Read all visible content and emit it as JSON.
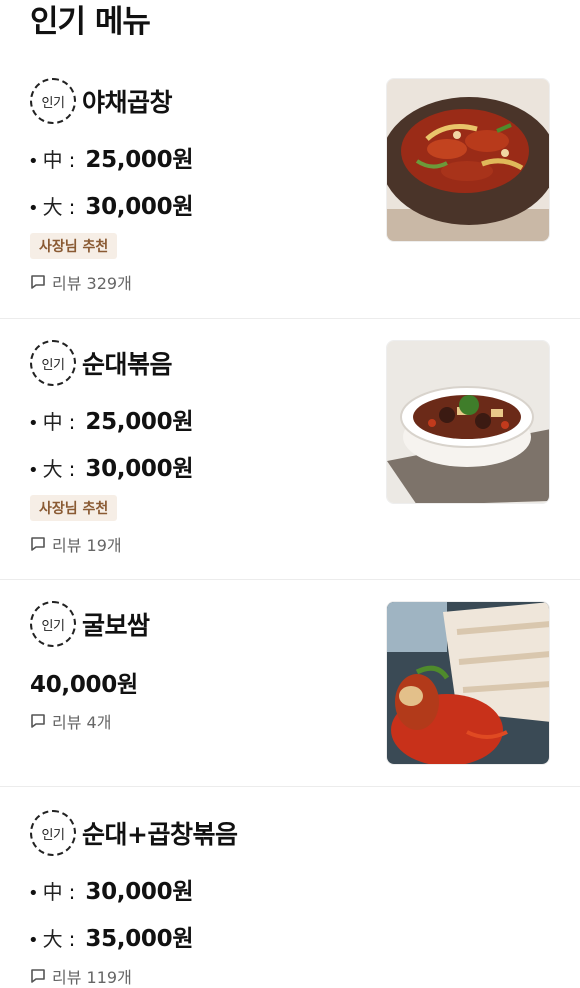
{
  "section": {
    "title": "인기 메뉴"
  },
  "badge_label": "인기",
  "items": [
    {
      "name": "야채곱창",
      "prices": [
        {
          "size": "中",
          "price": "25,000원"
        },
        {
          "size": "大",
          "price": "30,000원"
        }
      ],
      "tag": "사장님 추천",
      "reviews": "리뷰 329개"
    },
    {
      "name": "순대볶음",
      "prices": [
        {
          "size": "中",
          "price": "25,000원"
        },
        {
          "size": "大",
          "price": "30,000원"
        }
      ],
      "tag": "사장님 추천",
      "reviews": "리뷰 19개"
    },
    {
      "name": "굴보쌈",
      "price": "40,000원",
      "reviews": "리뷰 4개"
    },
    {
      "name": "순대+곱창볶음",
      "prices": [
        {
          "size": "中",
          "price": "30,000원"
        },
        {
          "size": "大",
          "price": "35,000원"
        }
      ],
      "reviews": "리뷰 119개"
    }
  ],
  "colors": {
    "tag_bg": "#f6eee6",
    "tag_text": "#8a5a33",
    "divider": "#ececec"
  }
}
